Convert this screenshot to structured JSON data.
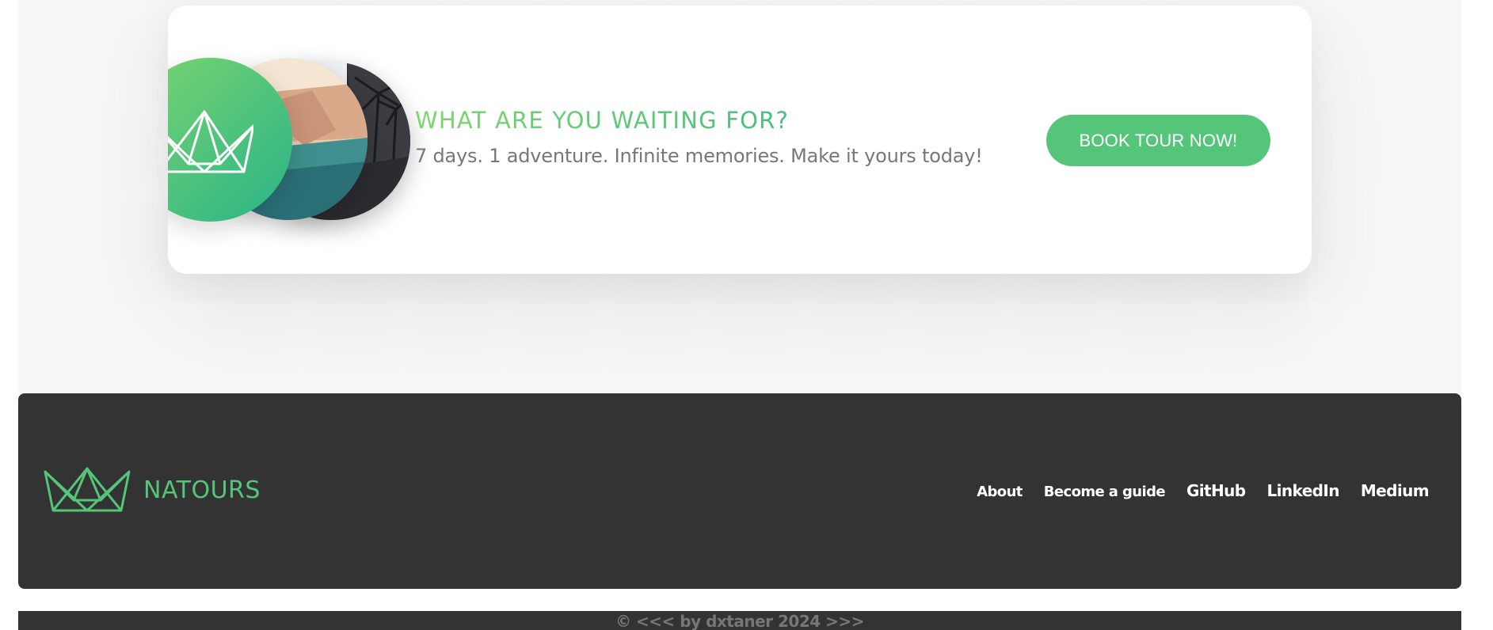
{
  "cta": {
    "heading": "WHAT ARE YOU WAITING FOR?",
    "subtext": "7 days. 1 adventure. Infinite memories. Make it yours today!",
    "button_label": "BOOK TOUR NOW!",
    "images": [
      "tour-photo-beach",
      "tour-photo-palms"
    ],
    "logo_icon": "natours-crown-icon"
  },
  "footer": {
    "brand": "NATOURS",
    "logo_icon": "natours-crown-icon",
    "nav": [
      {
        "label": "About"
      },
      {
        "label": "Become a guide"
      },
      {
        "label": "GitHub"
      },
      {
        "label": "LinkedIn"
      },
      {
        "label": "Medium"
      }
    ],
    "copyright": "© <<< by dxtaner 2024 >>>"
  },
  "colors": {
    "accent": "#55c57a",
    "accent_light": "#7ed56f",
    "accent_dark": "#28b485",
    "footer_bg": "#333333",
    "section_bg": "#f7f7f7",
    "text_gray": "#777777"
  }
}
